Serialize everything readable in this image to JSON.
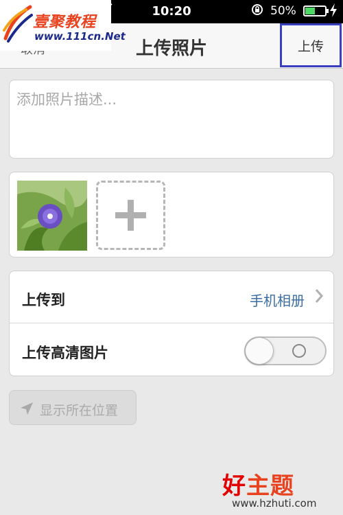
{
  "status_bar": {
    "time": "10:20",
    "battery_percent": "50%",
    "battery_level": 0.5
  },
  "watermark_top": {
    "name": "壹聚教程",
    "url": "www.111cn.Net"
  },
  "nav": {
    "back_label": "取消",
    "title": "上传照片",
    "upload_button": "上传"
  },
  "description": {
    "placeholder": "添加照片描述...",
    "value": ""
  },
  "photos": {
    "thumbnail_icon": "flower-photo",
    "add_icon": "plus-icon"
  },
  "settings": {
    "upload_to_label": "上传到",
    "upload_to_value": "手机相册",
    "hd_label": "上传高清图片",
    "hd_enabled": false
  },
  "location": {
    "label": "显示所在位置",
    "icon": "location-arrow-icon"
  },
  "watermark_bottom": {
    "name_part1": "好",
    "name_part2": "主题",
    "url": "www.hzhuti.com"
  },
  "colors": {
    "highlight_border": "#3a3fc0",
    "link_blue": "#3a6ea5",
    "battery_green": "#4cd964"
  }
}
